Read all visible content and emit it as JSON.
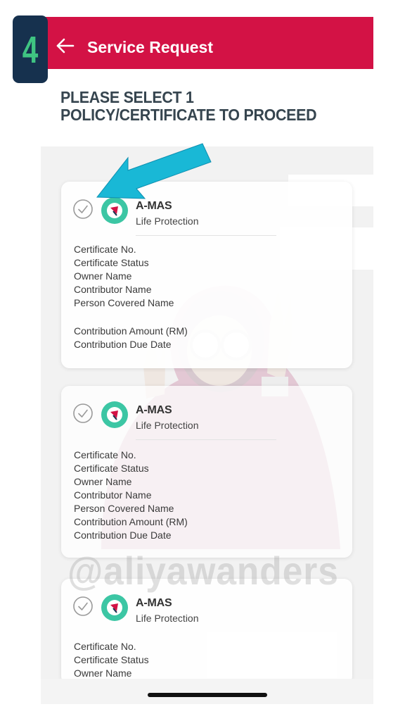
{
  "step_badge": {
    "number": "4"
  },
  "header": {
    "title": "Service Request",
    "back_icon": "arrow-left-icon",
    "color": "#d31245"
  },
  "instruction": "PLEASE SELECT 1 POLICY/CERTIFICATE TO PROCEED",
  "policies": [
    {
      "product": "A-MAS",
      "type": "Life Protection",
      "fields": [
        "Certificate No.",
        "Certificate Status",
        "Owner Name",
        "Contributor Name",
        "Person Covered Name",
        "Contribution Amount (RM)",
        "Contribution Due Date"
      ]
    },
    {
      "product": "A-MAS",
      "type": "Life Protection",
      "fields": [
        "Certificate No.",
        "Certificate Status",
        "Owner Name",
        "Contributor Name",
        "Person Covered Name",
        "Contribution Amount (RM)",
        "Contribution Due Date"
      ]
    },
    {
      "product": "A-MAS",
      "type": "Life Protection",
      "fields": [
        "Certificate No.",
        "Certificate Status",
        "Owner Name"
      ]
    }
  ],
  "watermark": "@aliyawanders",
  "annotation": {
    "icon": "arrow-annotation-icon",
    "color": "#19b8d6"
  },
  "colors": {
    "brand": "#d31245",
    "badge_bg": "#16314e",
    "badge_fg": "#3fc482",
    "logo": "#3cc6a4",
    "arrow": "#19b8d6"
  }
}
